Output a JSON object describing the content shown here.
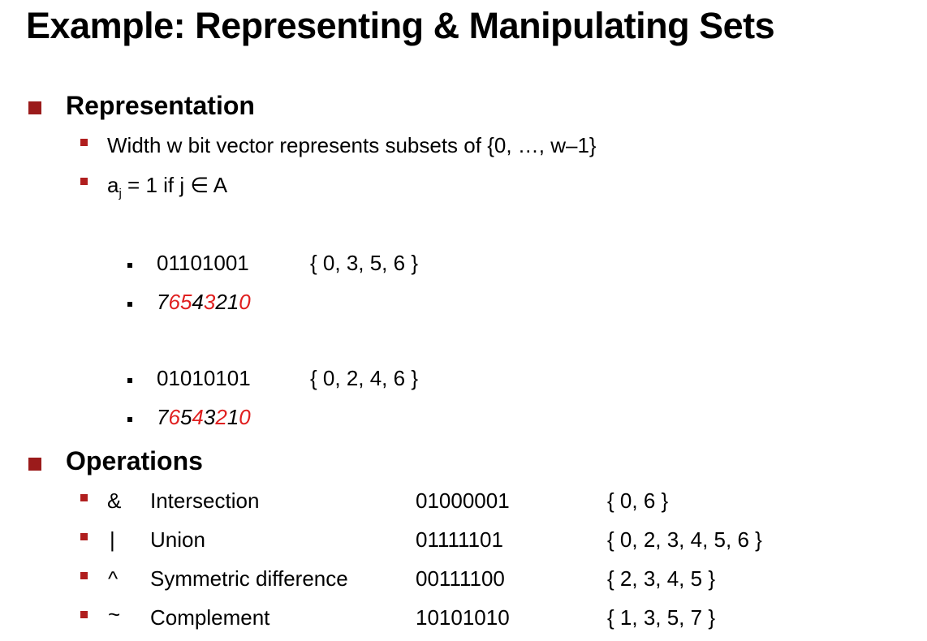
{
  "slide": {
    "title": "Example: Representing & Manipulating Sets"
  },
  "representation": {
    "heading": "Representation",
    "bullets": {
      "width": "Width w bit vector represents subsets of {0, …, w–1}",
      "aj_base": "a",
      "aj_sub": "j",
      "aj_rest": " = 1 if j  ∈ A"
    },
    "examples": [
      {
        "bits": "01101001",
        "set": "{ 0, 3, 5, 6 }",
        "index_digits": [
          "7",
          "6",
          "5",
          "4",
          "3",
          "2",
          "1",
          "0"
        ],
        "index_red": [
          false,
          true,
          true,
          false,
          true,
          false,
          false,
          true
        ]
      },
      {
        "bits": "01010101",
        "set": "{ 0, 2, 4, 6 }",
        "index_digits": [
          "7",
          "6",
          "5",
          "4",
          "3",
          "2",
          "1",
          "0"
        ],
        "index_red": [
          false,
          true,
          false,
          true,
          false,
          true,
          false,
          true
        ]
      }
    ]
  },
  "operations": {
    "heading": "Operations",
    "rows": [
      {
        "symbol": "&",
        "name": "Intersection",
        "bits": "01000001",
        "set": "{ 0, 6 }"
      },
      {
        "symbol": "|",
        "name": "Union",
        "bits": "01111101",
        "set": "{ 0, 2, 3, 4, 5, 6 }"
      },
      {
        "symbol": "^",
        "name": "Symmetric difference",
        "bits": "00111100",
        "set": "{ 2, 3, 4, 5 }"
      },
      {
        "symbol": "~",
        "name": "Complement",
        "bits": "10101010",
        "set": "{ 1, 3, 5, 7 }"
      }
    ]
  },
  "colors": {
    "accent_red": "#e02020",
    "bullet_red": "#9b1b1b"
  }
}
